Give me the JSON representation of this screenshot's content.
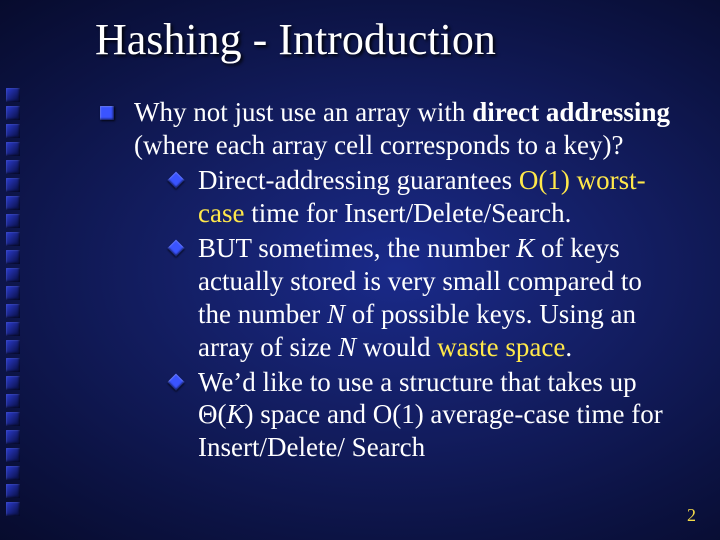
{
  "title": "Hashing - Introduction",
  "lvl1": {
    "pre": "Why not just use an array with ",
    "bold": "direct addressing",
    "post": " (where each array cell corresponds to a key)?"
  },
  "sub1": {
    "a": "Direct-addressing guarantees ",
    "y1": "O(1) worst-case",
    "b": " time for Insert/Delete/Search."
  },
  "sub2": {
    "a": "BUT sometimes, the number ",
    "k": "K",
    "b": " of keys actually stored is very small compared to the number ",
    "n1": "N",
    "c": " of possible keys. Using an array of size ",
    "n2": "N",
    "d": " would ",
    "y1": "waste space",
    "e": "."
  },
  "sub3": {
    "a": "We’d like to use a structure that takes up Θ(",
    "k": "K",
    "b": ") space and O(1) average-case time for Insert/Delete/ Search"
  },
  "page_number": "2"
}
